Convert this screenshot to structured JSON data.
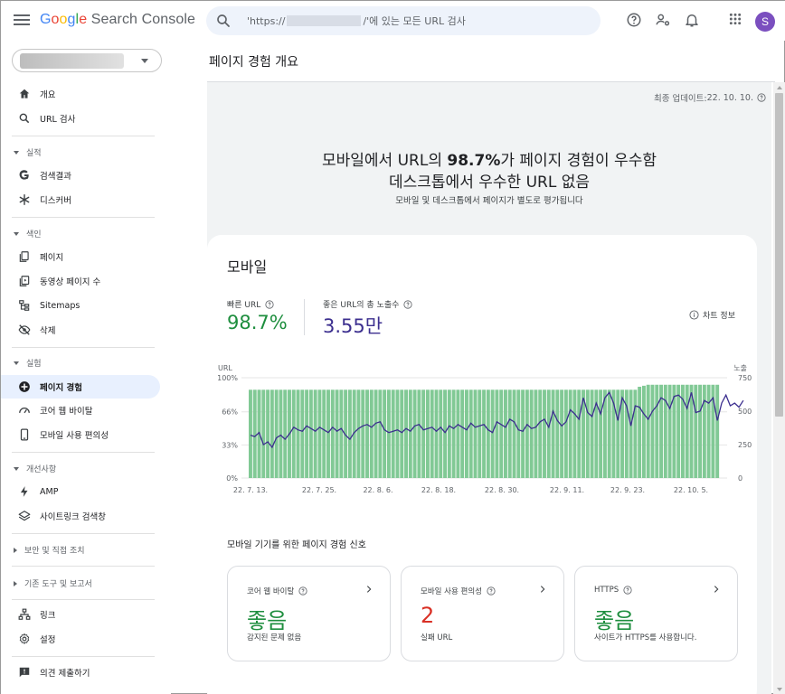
{
  "app": {
    "logo_parts": [
      "G",
      "o",
      "o",
      "g",
      "l",
      "e"
    ],
    "logo_rest": " Search Console",
    "avatar_letter": "S"
  },
  "search": {
    "prefix": "'https://",
    "suffix": "/'에 있는 모든 URL 검사"
  },
  "sidebar": {
    "items": [
      {
        "label": "개요",
        "icon": "home-icon"
      },
      {
        "label": "URL 검사",
        "icon": "search-icon"
      }
    ],
    "sections": [
      {
        "label": "실적",
        "items": [
          {
            "label": "검색결과",
            "icon": "google-g-icon"
          },
          {
            "label": "디스커버",
            "icon": "asterisk-icon"
          }
        ]
      },
      {
        "label": "색인",
        "items": [
          {
            "label": "페이지",
            "icon": "pages-icon"
          },
          {
            "label": "동영상 페이지 수",
            "icon": "video-pages-icon"
          },
          {
            "label": "Sitemaps",
            "icon": "sitemap-icon"
          },
          {
            "label": "삭제",
            "icon": "eye-off-icon"
          }
        ]
      },
      {
        "label": "실험",
        "items": [
          {
            "label": "페이지 경험",
            "icon": "page-experience-icon"
          },
          {
            "label": "코어 웹 바이탈",
            "icon": "gauge-icon"
          },
          {
            "label": "모바일 사용 편의성",
            "icon": "phone-icon"
          }
        ]
      },
      {
        "label": "개선사항",
        "items": [
          {
            "label": "AMP",
            "icon": "bolt-icon"
          },
          {
            "label": "사이트링크 검색창",
            "icon": "layers-icon"
          }
        ]
      },
      {
        "label": "보안 및 직접 조치",
        "items": []
      },
      {
        "label": "기존 도구 및 보고서",
        "items": []
      }
    ],
    "bottom_items": [
      {
        "label": "링크",
        "icon": "links-icon"
      },
      {
        "label": "설정",
        "icon": "settings-icon"
      },
      {
        "label": "의견 제출하기",
        "icon": "feedback-icon"
      }
    ]
  },
  "main": {
    "page_title": "페이지 경험 개요",
    "updated_label": "최종 업데이트: ",
    "updated_value": "22. 10. 10.",
    "headline_1_pre": "모바일에서 URL의 ",
    "headline_1_bold": "98.7%",
    "headline_1_post": "가 페이지 경험이 우수함",
    "headline_2": "데스크톱에서 우수한 URL 없음",
    "subline": "모바일 및 데스크톱에서 페이지가 별도로 평가됩니다"
  },
  "card": {
    "title": "모바일",
    "metric_1_label": "빠른 URL",
    "metric_1_value": "98.7%",
    "metric_2_label": "좋은 URL의 총 노출수",
    "metric_2_value": "3.55만",
    "chart_info": "차트 정보",
    "signals_title": "모바일 기기를 위한 페이지 경험 신호",
    "signals": [
      {
        "label": "코어 웹 바이탈",
        "value": "좋음",
        "desc": "감지된 문제 없음",
        "tone": "green",
        "has_help": true
      },
      {
        "label": "모바일 사용 편의성",
        "value": "2",
        "desc": "실패 URL",
        "tone": "red",
        "has_help": true
      },
      {
        "label": "HTTPS",
        "value": "좋음",
        "desc": "사이트가 HTTPS를 사용합니다.",
        "tone": "green",
        "has_help": true
      }
    ]
  },
  "colors": {
    "bar": "#81c995",
    "line": "#3c2f8f",
    "accent_green": "#1e8e3e",
    "accent_red": "#d93025",
    "active_nav": "#e8f0fe"
  },
  "chart_data": {
    "type": "bar",
    "left_axis_label": "URL",
    "right_axis_label": "노출",
    "left_ticks": [
      "100%",
      "66%",
      "33%",
      "0%"
    ],
    "right_ticks": [
      "750",
      "500",
      "250",
      "0"
    ],
    "ylim_left": [
      0,
      100
    ],
    "ylim_right": [
      0,
      750
    ],
    "x_tick_labels": [
      "22. 7. 13.",
      "22. 7. 25.",
      "22. 8. 6.",
      "22. 8. 18.",
      "22. 8. 30.",
      "22. 9. 11.",
      "22. 9. 23.",
      "22. 10. 5."
    ],
    "series": [
      {
        "name": "빠른 URL",
        "type": "bar",
        "axis": "left",
        "values": [
          88,
          88,
          88,
          88,
          88,
          88,
          88,
          88,
          88,
          88,
          88,
          88,
          88,
          88,
          88,
          88,
          88,
          88,
          88,
          88,
          88,
          88,
          88,
          88,
          88,
          88,
          88,
          88,
          88,
          88,
          88,
          88,
          88,
          88,
          88,
          88,
          88,
          88,
          88,
          88,
          88,
          88,
          88,
          88,
          88,
          88,
          88,
          88,
          88,
          88,
          88,
          88,
          88,
          88,
          88,
          88,
          88,
          88,
          88,
          88,
          88,
          88,
          88,
          88,
          88,
          88,
          88,
          88,
          88,
          88,
          88,
          88,
          88,
          88,
          88,
          88,
          88,
          88,
          88,
          88,
          88,
          88,
          88,
          88,
          88,
          88,
          88,
          88,
          88,
          88,
          91,
          92,
          93,
          93,
          93,
          93,
          93,
          93,
          93,
          93,
          93,
          93,
          93,
          93,
          93,
          93,
          93,
          93,
          93
        ]
      },
      {
        "name": "좋은 URL의 총 노출수",
        "type": "line",
        "axis": "right",
        "values": [
          320,
          310,
          340,
          250,
          270,
          230,
          300,
          320,
          290,
          330,
          380,
          360,
          350,
          390,
          370,
          350,
          380,
          360,
          340,
          380,
          350,
          370,
          320,
          290,
          340,
          370,
          390,
          400,
          380,
          410,
          420,
          360,
          340,
          350,
          360,
          340,
          370,
          350,
          390,
          400,
          360,
          370,
          380,
          350,
          380,
          340,
          390,
          370,
          400,
          380,
          360,
          410,
          380,
          390,
          400,
          360,
          340,
          420,
          400,
          380,
          440,
          420,
          360,
          350,
          400,
          370,
          380,
          420,
          440,
          380,
          500,
          430,
          390,
          420,
          510,
          480,
          440,
          600,
          490,
          460,
          560,
          480,
          600,
          640,
          560,
          430,
          600,
          540,
          390,
          540,
          530,
          480,
          440,
          500,
          540,
          600,
          580,
          520,
          610,
          620,
          590,
          520,
          640,
          490,
          500,
          580,
          560,
          600,
          430,
          560,
          620,
          540,
          560,
          530,
          580
        ]
      }
    ]
  }
}
